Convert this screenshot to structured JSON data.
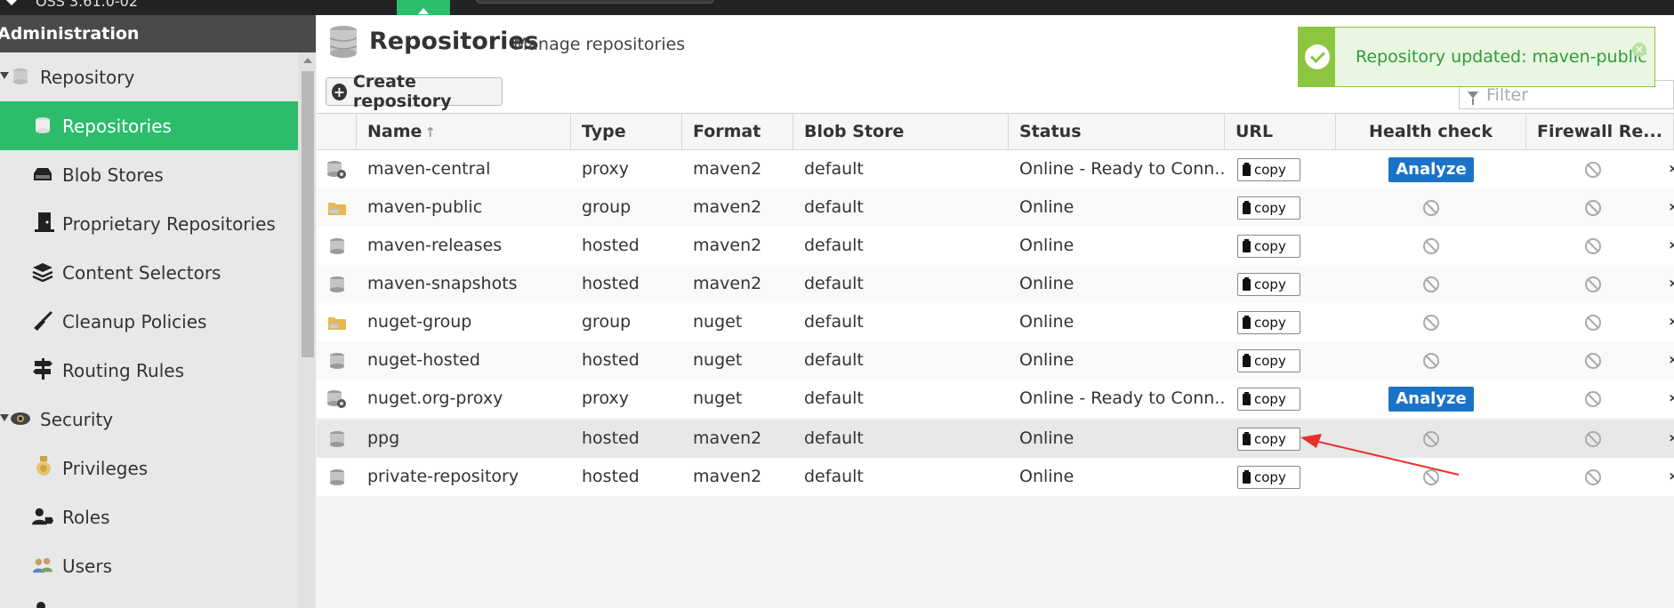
{
  "topbar": {
    "version": "OSS 3.61.0-02"
  },
  "sidebar": {
    "header": "Administration",
    "items": [
      {
        "label": "Repository",
        "icon": "database-icon",
        "group": true
      },
      {
        "label": "Repositories",
        "icon": "database-icon",
        "active": true
      },
      {
        "label": "Blob Stores",
        "icon": "drive-icon"
      },
      {
        "label": "Proprietary Repositories",
        "icon": "door-icon"
      },
      {
        "label": "Content Selectors",
        "icon": "layers-icon"
      },
      {
        "label": "Cleanup Policies",
        "icon": "broom-icon"
      },
      {
        "label": "Routing Rules",
        "icon": "signpost-icon"
      },
      {
        "label": "Security",
        "icon": "eye-icon",
        "group": true
      },
      {
        "label": "Privileges",
        "icon": "medal-icon"
      },
      {
        "label": "Roles",
        "icon": "user-tag-icon"
      },
      {
        "label": "Users",
        "icon": "users-icon"
      }
    ]
  },
  "header": {
    "title": "Repositories",
    "subtitle": "Manage repositories",
    "create_label": "Create repository",
    "filter_placeholder": "Filter"
  },
  "toast": {
    "message": "Repository updated: maven-public"
  },
  "table": {
    "columns": {
      "name": "Name",
      "type": "Type",
      "format": "Format",
      "blob": "Blob Store",
      "status": "Status",
      "url": "URL",
      "health": "Health check",
      "firewall": "Firewall Re..."
    },
    "copy_label": "copy",
    "analyze_label": "Analyze",
    "rows": [
      {
        "name": "maven-central",
        "type": "proxy",
        "format": "maven2",
        "blob": "default",
        "status": "Online - Ready to Conn...",
        "icon": "proxy-icon",
        "analyze": true
      },
      {
        "name": "maven-public",
        "type": "group",
        "format": "maven2",
        "blob": "default",
        "status": "Online",
        "icon": "group-folder-icon",
        "analyze": false
      },
      {
        "name": "maven-releases",
        "type": "hosted",
        "format": "maven2",
        "blob": "default",
        "status": "Online",
        "icon": "hosted-icon",
        "analyze": false
      },
      {
        "name": "maven-snapshots",
        "type": "hosted",
        "format": "maven2",
        "blob": "default",
        "status": "Online",
        "icon": "hosted-icon",
        "analyze": false
      },
      {
        "name": "nuget-group",
        "type": "group",
        "format": "nuget",
        "blob": "default",
        "status": "Online",
        "icon": "group-folder-icon",
        "analyze": false
      },
      {
        "name": "nuget-hosted",
        "type": "hosted",
        "format": "nuget",
        "blob": "default",
        "status": "Online",
        "icon": "hosted-icon",
        "analyze": false
      },
      {
        "name": "nuget.org-proxy",
        "type": "proxy",
        "format": "nuget",
        "blob": "default",
        "status": "Online - Ready to Conn...",
        "icon": "proxy-icon",
        "analyze": true
      },
      {
        "name": "ppg",
        "type": "hosted",
        "format": "maven2",
        "blob": "default",
        "status": "Online",
        "icon": "hosted-icon",
        "analyze": false,
        "highlighted": true
      },
      {
        "name": "private-repository",
        "type": "hosted",
        "format": "maven2",
        "blob": "default",
        "status": "Online",
        "icon": "hosted-icon",
        "analyze": false
      }
    ]
  },
  "colors": {
    "accent": "#2cbc6c",
    "analyze": "#1a73c9",
    "toast_border": "#8cc63f",
    "annotation": "#e8312a"
  }
}
